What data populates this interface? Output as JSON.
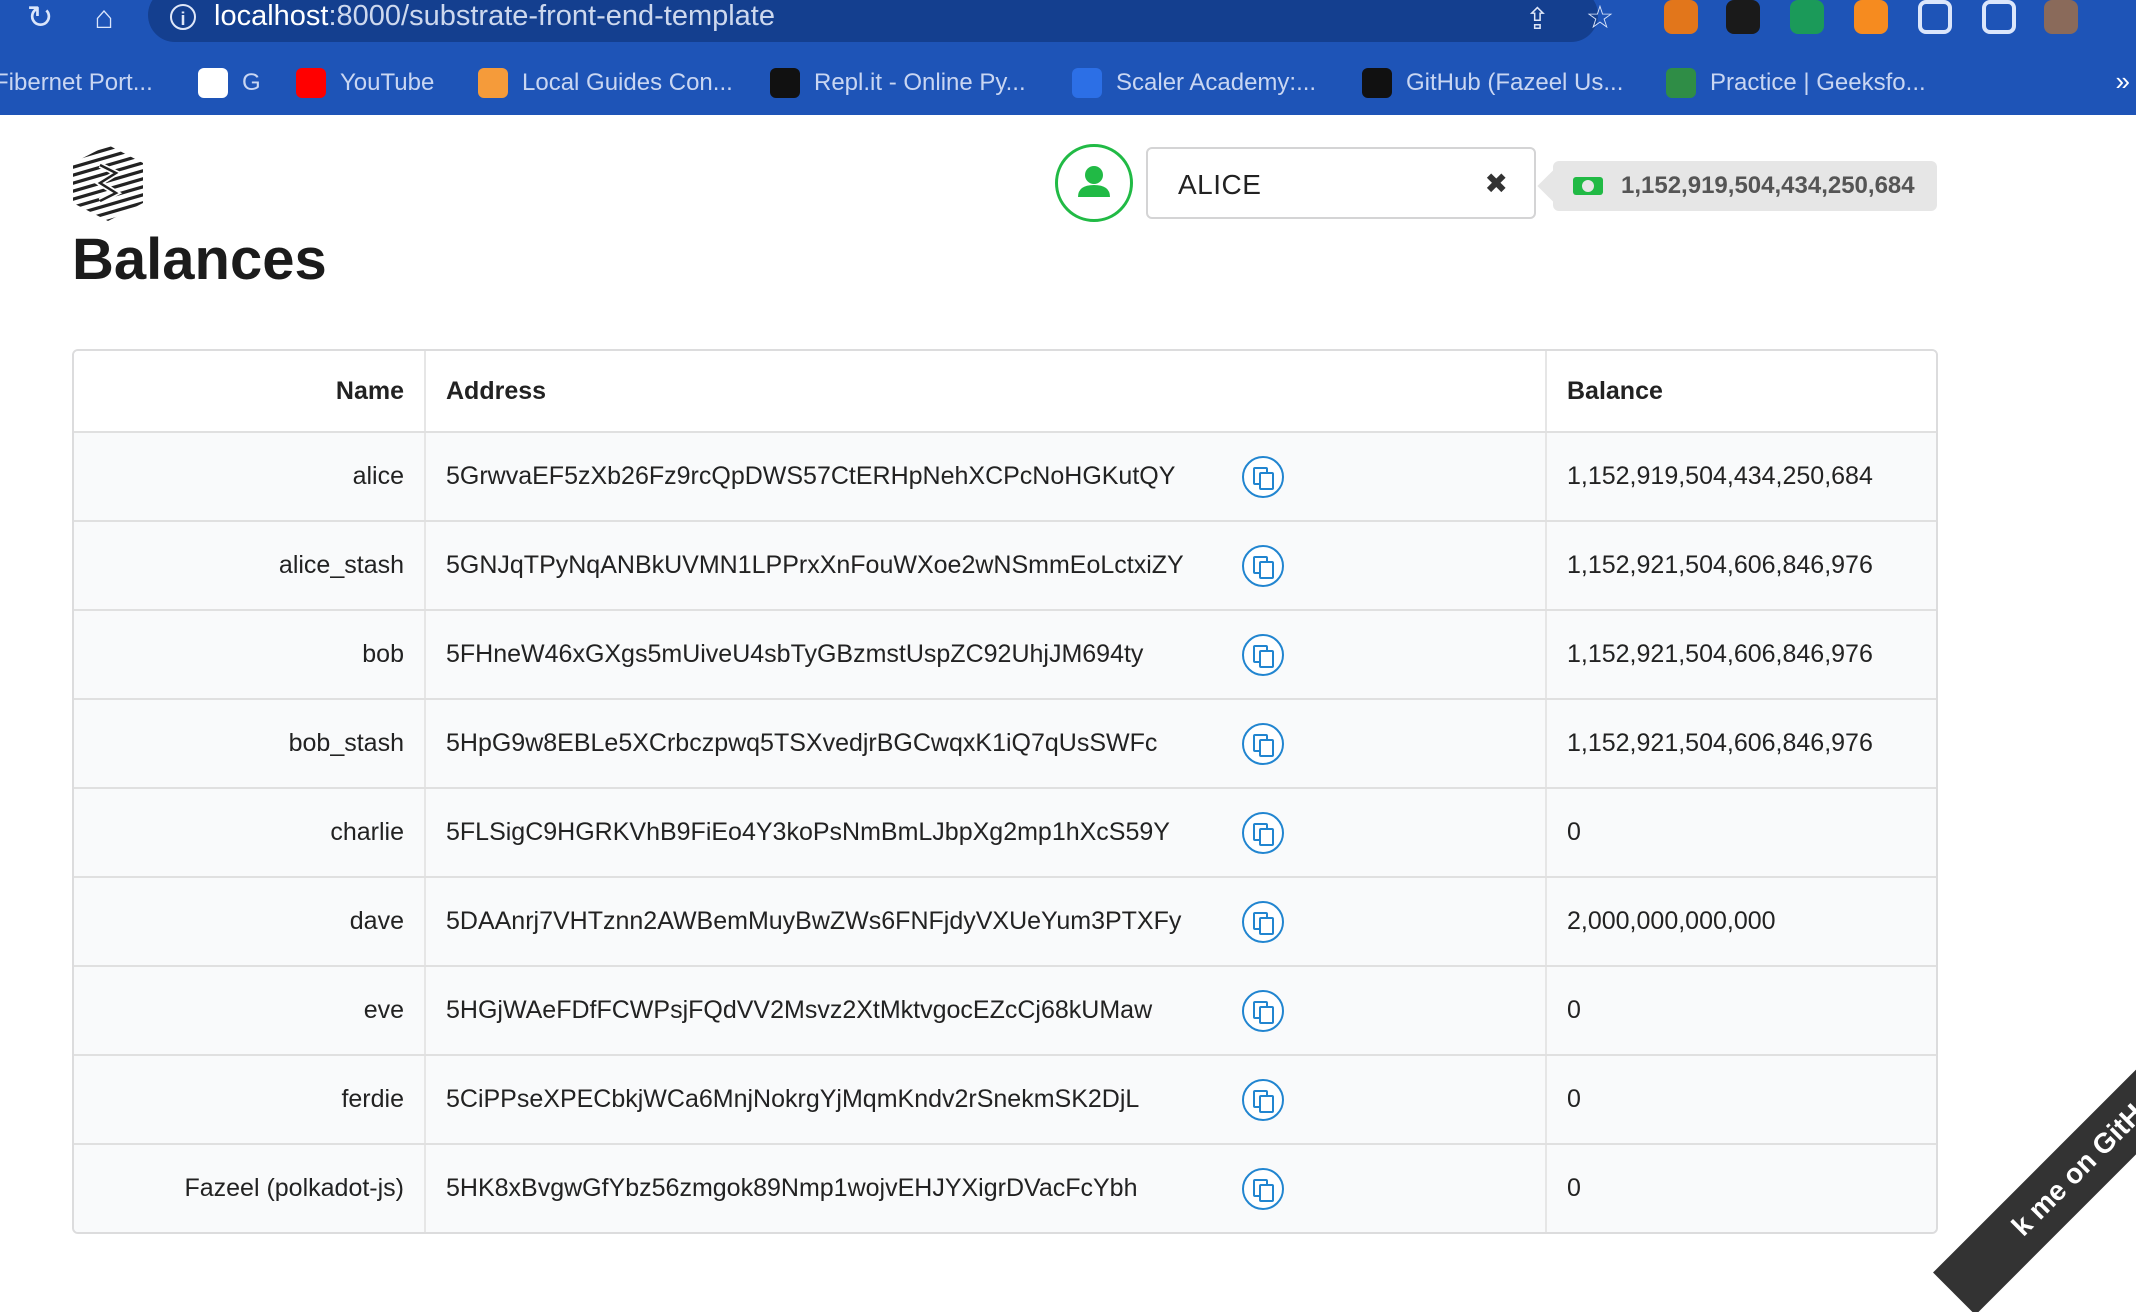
{
  "browser": {
    "url_host": "localhost",
    "url_path": ":8000/substrate-front-end-template",
    "bookmarks": [
      {
        "label": "Fibernet Port...",
        "color": "#1e54b7"
      },
      {
        "label": "G",
        "color": "#ffffff"
      },
      {
        "label": "YouTube",
        "color": "#ff0000"
      },
      {
        "label": "Local Guides Con...",
        "color": "#f59b3a"
      },
      {
        "label": "Repl.it - Online Py...",
        "color": "#111111"
      },
      {
        "label": "Scaler Academy:...",
        "color": "#2c6fe6"
      },
      {
        "label": "GitHub (Fazeel Us...",
        "color": "#111111"
      },
      {
        "label": "Practice | Geeksfo...",
        "color": "#2f8d46"
      }
    ],
    "more": "»",
    "extension_colors": [
      "#e2761b",
      "#1a1a1a",
      "#1b9a59",
      "#f68b1f",
      "#dbe6fb",
      "#dbe6fb",
      "#8a6a5a"
    ]
  },
  "header": {
    "account": "ALICE",
    "clear_icon": "✖",
    "balance": "1,152,919,504,434,250,684"
  },
  "page": {
    "title": "Balances"
  },
  "table": {
    "headers": {
      "name": "Name",
      "address": "Address",
      "balance": "Balance"
    },
    "rows": [
      {
        "name": "alice",
        "address": "5GrwvaEF5zXb26Fz9rcQpDWS57CtERHpNehXCPcNoHGKutQY",
        "balance": "1,152,919,504,434,250,684"
      },
      {
        "name": "alice_stash",
        "address": "5GNJqTPyNqANBkUVMN1LPPrxXnFouWXoe2wNSmmEoLctxiZY",
        "balance": "1,152,921,504,606,846,976"
      },
      {
        "name": "bob",
        "address": "5FHneW46xGXgs5mUiveU4sbTyGBzmstUspZC92UhjJM694ty",
        "balance": "1,152,921,504,606,846,976"
      },
      {
        "name": "bob_stash",
        "address": "5HpG9w8EBLe5XCrbczpwq5TSXvedjrBGCwqxK1iQ7qUsSWFc",
        "balance": "1,152,921,504,606,846,976"
      },
      {
        "name": "charlie",
        "address": "5FLSigC9HGRKVhB9FiEo4Y3koPsNmBmLJbpXg2mp1hXcS59Y",
        "balance": "0"
      },
      {
        "name": "dave",
        "address": "5DAAnrj7VHTznn2AWBemMuyBwZWs6FNFjdyVXUeYum3PTXFy",
        "balance": "2,000,000,000,000"
      },
      {
        "name": "eve",
        "address": "5HGjWAeFDfFCWPsjFQdVV2Msvz2XtMktvgocEZcCj68kUMaw",
        "balance": "0"
      },
      {
        "name": "ferdie",
        "address": "5CiPPseXPECbkjWCa6MnjNokrgYjMqmKndv2rSnekmSK2DjL",
        "balance": "0"
      },
      {
        "name": "Fazeel (polkadot-js)",
        "address": "5HK8xBvgwGfYbz56zmgok89Nmp1wojvEHJYXigrDVacFcYbh",
        "balance": "0"
      }
    ]
  },
  "ribbon": {
    "text": "k me on GitHub"
  }
}
